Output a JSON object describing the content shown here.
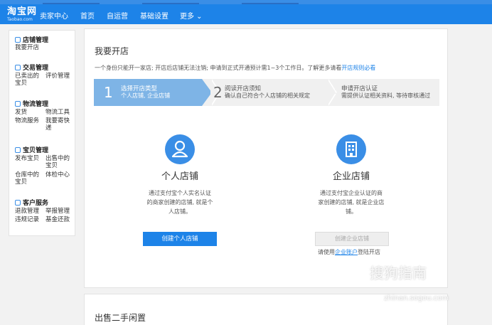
{
  "nav": {
    "logo_cn": "淘宝网",
    "logo_en": "Taobao.com",
    "seller_center": "卖家中心",
    "links": [
      "首页",
      "自运营",
      "基础设置",
      "更多 ⌄"
    ]
  },
  "sidebar": {
    "sections": [
      {
        "title": "店铺管理",
        "icon": "shop-icon",
        "items": [
          "我要开店"
        ]
      },
      {
        "title": "交易管理",
        "icon": "trade-icon",
        "items": [
          "已卖出的宝贝",
          "评价管理"
        ]
      },
      {
        "title": "物流管理",
        "icon": "logistics-icon",
        "items": [
          "发货",
          "物流工具",
          "物流服务",
          "我要寄快递"
        ]
      },
      {
        "title": "宝贝管理",
        "icon": "goods-icon",
        "items": [
          "发布宝贝",
          "出售中的宝贝",
          "仓库中的宝贝",
          "体检中心"
        ]
      },
      {
        "title": "客户服务",
        "icon": "service-icon",
        "items": [
          "退款管理",
          "举报管理",
          "违规记录",
          "基金还款"
        ]
      }
    ]
  },
  "main": {
    "title": "我要开店",
    "notice": "一个身份只能开一家店; 开店后店铺无法注销; 申请到正式开通预计需1~3个工作日。了解更多请看",
    "notice_link": "开店规则必看",
    "steps": [
      {
        "num": "1",
        "title": "选择开店类型",
        "desc": "个人店铺, 企业店铺"
      },
      {
        "num": "2",
        "title": "阅读开店须知",
        "desc": "确认自己符合个人店铺的相关规定"
      },
      {
        "num": "3",
        "title": "申请开店认证",
        "desc": "需提供认证相关资料, 等待审核通过"
      }
    ],
    "personal": {
      "icon": "person-icon",
      "title": "个人店铺",
      "desc": [
        "通过支付宝个人实名认证",
        "的商家创建的店铺, 就是个",
        "人店铺。"
      ],
      "button": "创建个人店铺"
    },
    "enterprise": {
      "icon": "building-icon",
      "title": "企业店铺",
      "desc": [
        "通过支付宝企业认证的商",
        "家创建的店铺, 就是企业店",
        "铺。"
      ],
      "button": "创建企业店铺",
      "note_prefix": "请使用",
      "note_link": "企业账户",
      "note_suffix": "登陆开店"
    },
    "second_title": "出售二手闲置"
  },
  "watermark": {
    "text": "搜狗指南",
    "url_text": "zhinan.sogou.com"
  },
  "colors": {
    "nav": "#1d83e8",
    "accent": "#3a8ee6",
    "step_active": "#7eb4e6"
  }
}
